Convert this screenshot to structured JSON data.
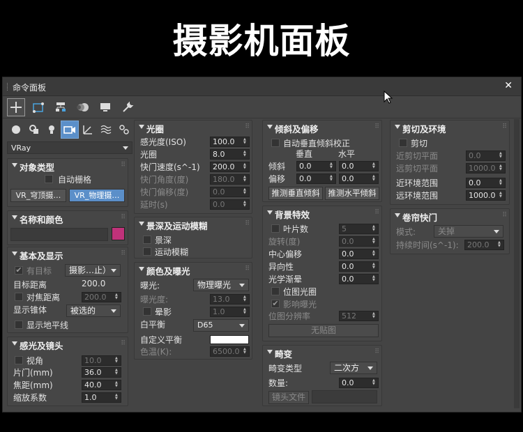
{
  "banner": {
    "title": "摄影机面板"
  },
  "window": {
    "title": "命令面板",
    "close": "✕"
  },
  "toolbar": {
    "icons": [
      "plus-icon",
      "modify-icon",
      "hierarchy-icon",
      "motion-icon",
      "display-icon",
      "utilities-icon"
    ]
  },
  "subtoolbar": {
    "icons": [
      "sphere-icon",
      "shapes-icon",
      "light-icon",
      "camera-icon",
      "helper-icon",
      "spacewarp-icon",
      "systems-icon"
    ]
  },
  "category_dropdown": "VRay",
  "object_type": {
    "title": "对象类型",
    "autogrid": "自动栅格",
    "btn1": "VR_穹顶摄…",
    "btn2": "VR_物理摄…"
  },
  "name_color": {
    "title": "名称和颜色",
    "color": "#c0327a"
  },
  "basic_display": {
    "title": "基本及显示",
    "targeted": "有目标",
    "targeted_dd": "摄影…止）",
    "target_dist_label": "目标距离",
    "target_dist": "200.0",
    "focus_dist_label": "对焦距离",
    "focus_dist": "200.0",
    "show_cone_label": "显示锥体",
    "show_cone": "被选的",
    "show_horizon": "显示地平线"
  },
  "sensor": {
    "title": "感光及镜头",
    "fov": "视角",
    "fov_val": "10.0",
    "film_label": "片门(mm)",
    "film": "36.0",
    "focal_label": "焦距(mm)",
    "focal": "40.0",
    "zoom_label": "缩放系数",
    "zoom": "1.0"
  },
  "aperture": {
    "title": "光圈",
    "iso_label": "感光度(ISO)",
    "iso": "100.0",
    "fnum_label": "光圈",
    "fnum": "8.0",
    "shutter_label": "快门速度(s^-1)",
    "shutter": "200.0",
    "angle_label": "快门角度(度)",
    "angle": "180.0",
    "offset_label": "快门偏移(度)",
    "offset": "0.0",
    "latency_label": "延时(s)",
    "latency": "0.0"
  },
  "dof": {
    "title": "景深及运动模糊",
    "dof": "景深",
    "mblur": "运动模糊"
  },
  "color_exposure": {
    "title": "颜色及曝光",
    "exposure_label": "曝光:",
    "exposure": "物理曝光",
    "ev_label": "曝光度:",
    "ev": "13.0",
    "vignette_label": "晕影",
    "vignette": "1.0",
    "wb_label": "白平衡",
    "wb": "D65",
    "custom_wb_label": "自定义平衡",
    "temp_label": "色温(K):",
    "temp": "6500.0"
  },
  "tilt": {
    "title": "倾斜及偏移",
    "auto_label": "自动垂直倾斜校正",
    "vertical": "垂直",
    "horizontal": "水平",
    "tilt_label": "倾斜",
    "tilt_v": "0.0",
    "tilt_h": "0.0",
    "shift_label": "偏移",
    "shift_v": "0.0",
    "shift_h": "0.0",
    "btn_v": "推测垂直倾斜",
    "btn_h": "推测水平倾斜"
  },
  "bokeh": {
    "title": "背景特效",
    "blades_label": "叶片数",
    "blades": "5",
    "rotation_label": "旋转(度)",
    "rotation": "0.0",
    "center_label": "中心偏移",
    "center": "0.0",
    "aniso_label": "异向性",
    "aniso": "0.0",
    "optical_label": "光学渐晕",
    "optical": "0.0",
    "bitmap_label": "位图光圈",
    "affect_label": "影响曝光",
    "res_label": "位图分辨率",
    "res": "512",
    "nomap": "无贴图"
  },
  "distortion": {
    "title": "畸变",
    "type_label": "畸变类型",
    "type": "二次方",
    "amount_label": "数量:",
    "amount": "0.0",
    "lens_btn": "镜头文件"
  },
  "clipping": {
    "title": "剪切及环境",
    "clip_label": "剪切",
    "near_clip_label": "近剪切平面",
    "near_clip": "0.0",
    "far_clip_label": "远剪切平面",
    "far_clip": "1000.0",
    "near_env_label": "近环境范围",
    "near_env": "0.0",
    "far_env_label": "远环境范围",
    "far_env": "1000.0"
  },
  "rolling": {
    "title": "卷帘快门",
    "mode_label": "模式:",
    "mode": "关掉",
    "duration_label": "持续时间(s^-1):",
    "duration": "200.0"
  }
}
